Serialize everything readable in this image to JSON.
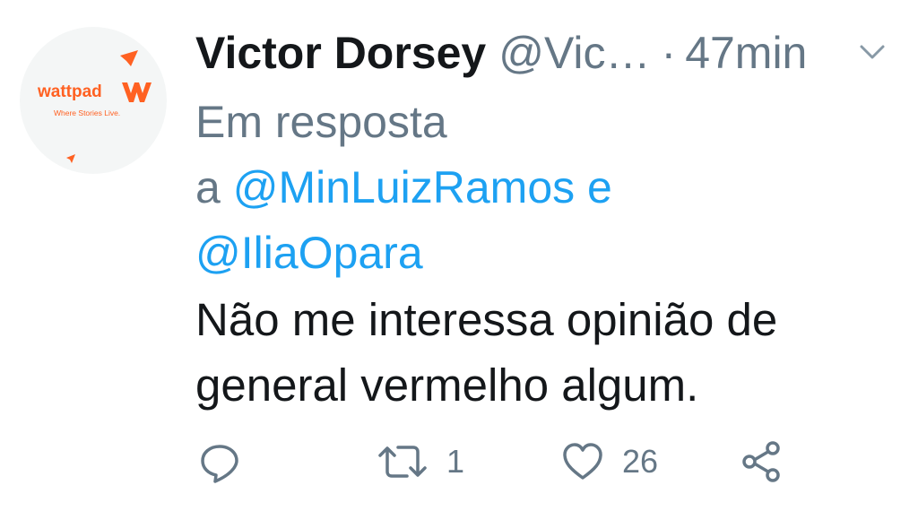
{
  "tweet": {
    "avatar": {
      "brand": "wattpad",
      "tagline": "Where Stories Live.",
      "accent": "#ff6122"
    },
    "author_name": "Victor Dorsey",
    "handle": "@Vic…",
    "separator": "·",
    "time": "47min",
    "reply_prefix_line1": "Em resposta",
    "reply_prefix_line2": "a",
    "mention_1": "@MinLuizRamos",
    "reply_conjunction": "e",
    "mention_2": "@IliaOpara",
    "text_line1": "Não me interessa opinião de",
    "text_line2": "general vermelho algum.",
    "actions": {
      "reply_icon": "comment-icon",
      "retweet_icon": "retweet-icon",
      "retweet_count": "1",
      "like_icon": "heart-icon",
      "like_count": "26",
      "share_icon": "share-icon"
    },
    "colors": {
      "text": "#14171a",
      "secondary": "#657786",
      "link": "#1da1f2"
    }
  }
}
